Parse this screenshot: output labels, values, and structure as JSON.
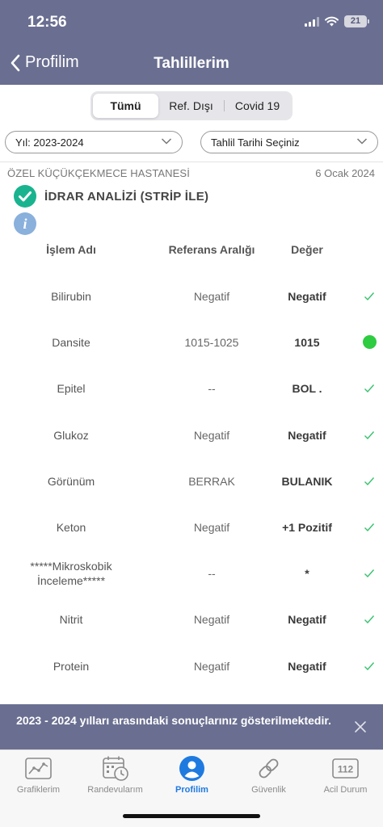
{
  "status_bar": {
    "time": "12:56",
    "battery": "21"
  },
  "nav": {
    "back_label": "Profilim",
    "title": "Tahlillerim"
  },
  "segments": [
    "Tümü",
    "Ref. Dışı",
    "Covid 19"
  ],
  "filters": {
    "year": "Yıl: 2023-2024",
    "date": "Tahlil Tarihi Seçiniz"
  },
  "result": {
    "hospital": "ÖZEL KÜÇÜKÇEKMECE HASTANESİ",
    "date": "6 Ocak 2024",
    "test_name": "İDRAR ANALİZİ (STRİP İLE)"
  },
  "table": {
    "headers": [
      "İşlem Adı",
      "Referans Aralığı",
      "Değer"
    ],
    "rows": [
      {
        "name": "Bilirubin",
        "ref": "Negatif",
        "value": "Negatif",
        "status": "check"
      },
      {
        "name": "Dansite",
        "ref": "1015-1025",
        "value": "1015",
        "status": "dot"
      },
      {
        "name": "Epitel",
        "ref": "--",
        "value": "BOL .",
        "status": "check"
      },
      {
        "name": "Glukoz",
        "ref": "Negatif",
        "value": "Negatif",
        "status": "check"
      },
      {
        "name": "Görünüm",
        "ref": "BERRAK",
        "value": "BULANIK",
        "status": "check"
      },
      {
        "name": "Keton",
        "ref": "Negatif",
        "value": "+1 Pozitif",
        "status": "check"
      },
      {
        "name": "*****Mikroskobik İnceleme*****",
        "ref": "--",
        "value": "*",
        "status": "check"
      },
      {
        "name": "Nitrit",
        "ref": "Negatif",
        "value": "Negatif",
        "status": "check"
      },
      {
        "name": "Protein",
        "ref": "Negatif",
        "value": "Negatif",
        "status": "check"
      }
    ]
  },
  "toast": {
    "message": "2023 - 2024 yılları arasındaki sonuçlarınız gösterilmektedir."
  },
  "tabs": [
    {
      "label": "Grafiklerim",
      "icon": "chart-icon"
    },
    {
      "label": "Randevularım",
      "icon": "calendar-clock-icon"
    },
    {
      "label": "Profilim",
      "icon": "user-icon",
      "active": true
    },
    {
      "label": "Güvenlik",
      "icon": "link-icon"
    },
    {
      "label": "Acil Durum",
      "icon": "emergency-112-icon",
      "badge": "112"
    }
  ],
  "colors": {
    "header": "#6a6f91",
    "accent": "#1f7ae0",
    "success": "#19b48f",
    "check": "#35c26d",
    "dot": "#2ecc40"
  }
}
